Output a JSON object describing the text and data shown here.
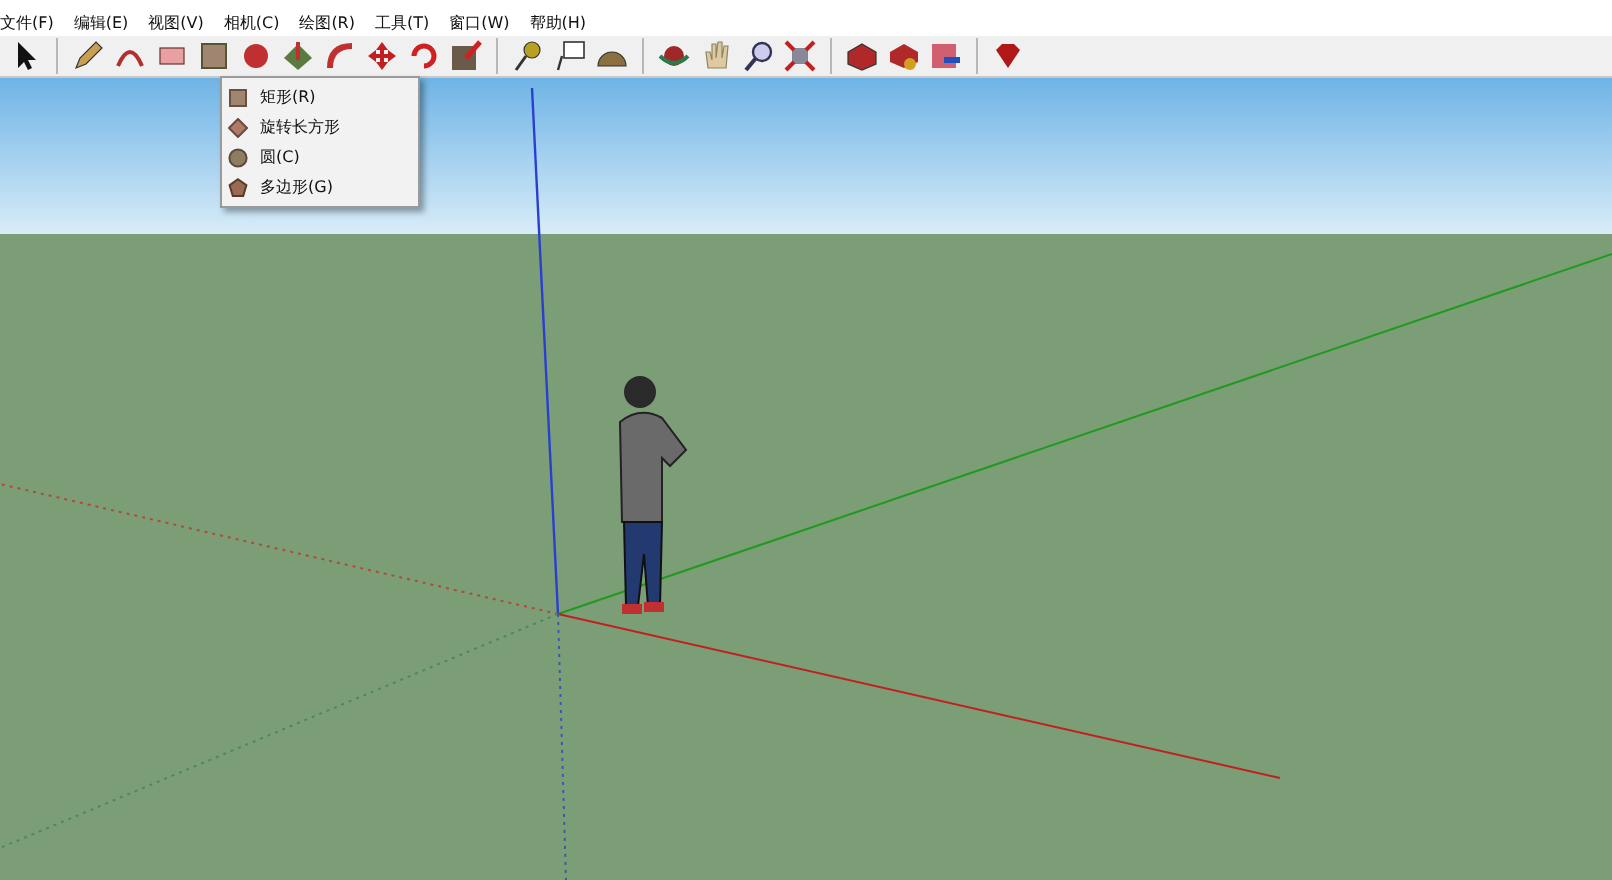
{
  "menu_bar": {
    "items": [
      {
        "label": "文件(F)"
      },
      {
        "label": "编辑(E)"
      },
      {
        "label": "视图(V)"
      },
      {
        "label": "相机(C)"
      },
      {
        "label": "绘图(R)"
      },
      {
        "label": "工具(T)"
      },
      {
        "label": "窗口(W)"
      },
      {
        "label": "帮助(H)"
      }
    ]
  },
  "dropdown": {
    "items": [
      {
        "label": "矩形(R)",
        "kind": "rectangle"
      },
      {
        "label": "旋转长方形",
        "kind": "rotated"
      },
      {
        "label": "圆(C)",
        "kind": "circle"
      },
      {
        "label": "多边形(G)",
        "kind": "polygon"
      }
    ]
  }
}
